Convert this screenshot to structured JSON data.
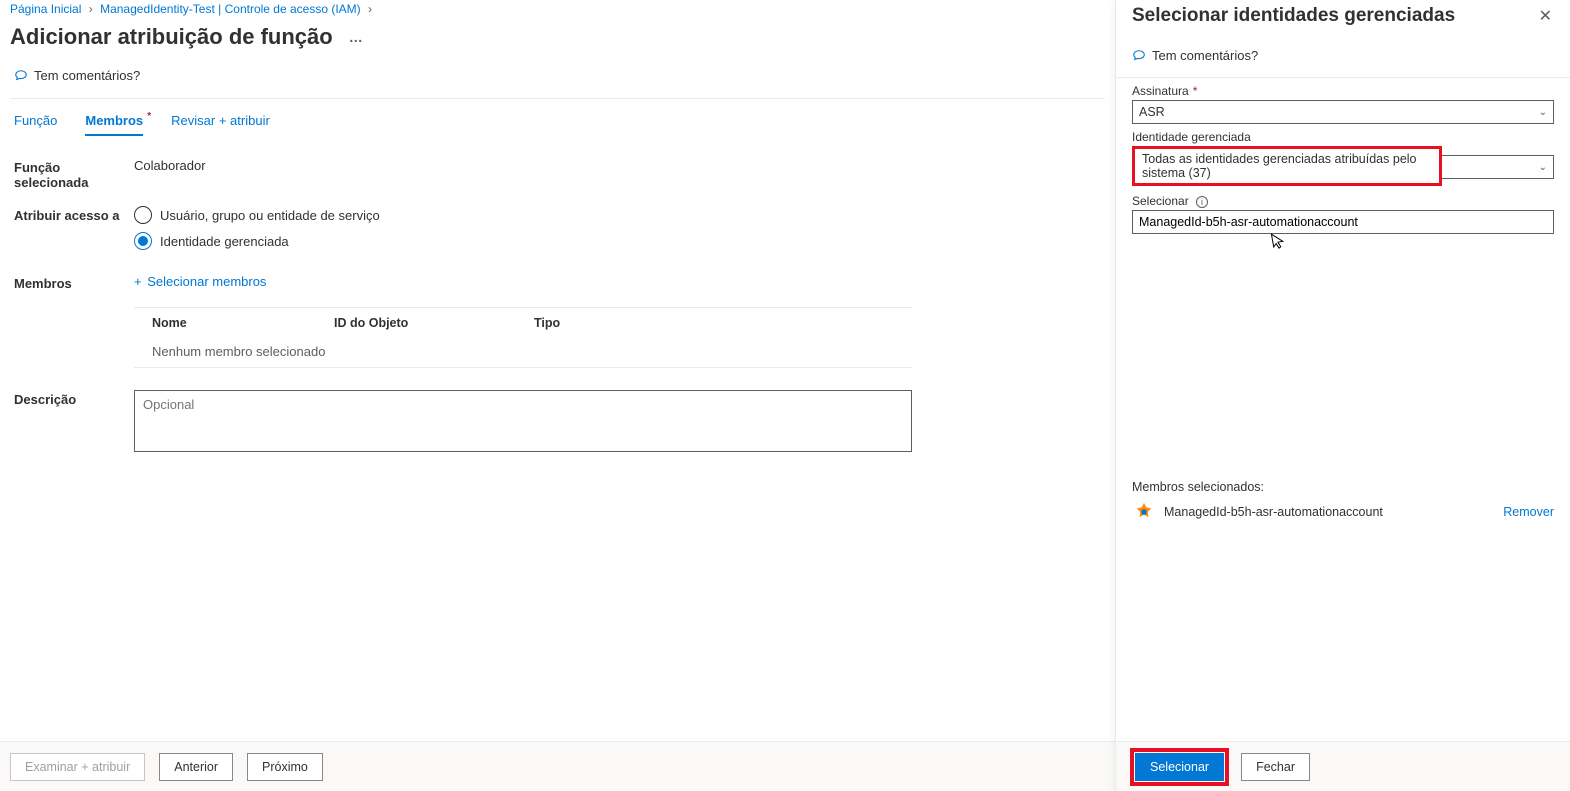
{
  "breadcrumb": {
    "home": "Página Inicial",
    "resource": "ManagedIdentity-Test",
    "iam": "Controle de acesso (IAM)"
  },
  "page_title": "Adicionar atribuição de função",
  "feedback_label": "Tem comentários?",
  "tabs": {
    "role": "Função",
    "members": "Membros",
    "review": "Revisar + atribuir"
  },
  "form": {
    "selected_role_label": "Função selecionada",
    "selected_role_value": "Colaborador",
    "assign_access_label": "Atribuir acesso a",
    "radio_user": "Usuário, grupo ou entidade de serviço",
    "radio_identity": "Identidade gerenciada",
    "members_label": "Membros",
    "select_members_link": "Selecionar membros",
    "table_headers": {
      "name": "Nome",
      "id": "ID do Objeto",
      "type": "Tipo"
    },
    "no_members": "Nenhum membro selecionado",
    "description_label": "Descrição",
    "description_placeholder": "Opcional"
  },
  "bottom_bar": {
    "review": "Examinar + atribuir",
    "previous": "Anterior",
    "next": "Próximo"
  },
  "side_panel": {
    "title": "Selecionar identidades gerenciadas",
    "feedback": "Tem comentários?",
    "subscription_label": "Assinatura",
    "subscription_value": "ASR",
    "identity_label": "Identidade gerenciada",
    "identity_value": "Todas as identidades gerenciadas atribuídas pelo sistema (37)",
    "select_label": "Selecionar",
    "select_value": "ManagedId-b5h-asr-automationaccount",
    "selected_members_label": "Membros selecionados:",
    "selected_member_name": "ManagedId-b5h-asr-automationaccount",
    "remove_label": "Remover",
    "select_btn": "Selecionar",
    "close_btn": "Fechar"
  }
}
